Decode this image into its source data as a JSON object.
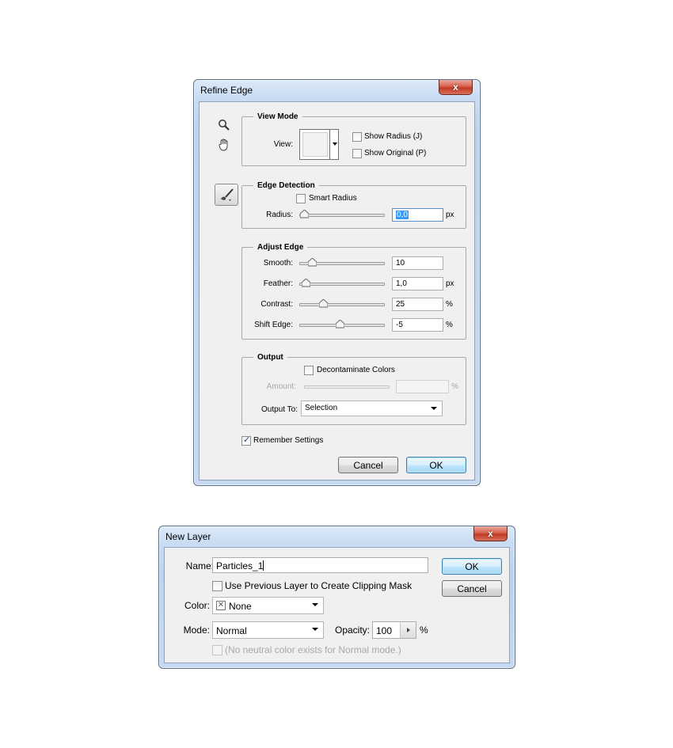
{
  "refine_edge": {
    "title": "Refine Edge",
    "close_label": "x",
    "view_mode": {
      "legend": "View Mode",
      "view_label": "View:",
      "show_radius": {
        "label": "Show Radius (J)",
        "checked": false
      },
      "show_original": {
        "label": "Show Original (P)",
        "checked": false
      }
    },
    "edge_detection": {
      "legend": "Edge Detection",
      "smart_radius": {
        "label": "Smart Radius",
        "checked": false
      },
      "radius_label": "Radius:",
      "radius_value": "0,0",
      "radius_unit": "px",
      "radius_slider_fraction": 0.0
    },
    "adjust_edge": {
      "legend": "Adjust Edge",
      "rows": [
        {
          "label": "Smooth:",
          "value": "10",
          "unit": "",
          "slider_fraction": 0.1
        },
        {
          "label": "Feather:",
          "value": "1,0",
          "unit": "px",
          "slider_fraction": 0.02
        },
        {
          "label": "Contrast:",
          "value": "25",
          "unit": "%",
          "slider_fraction": 0.25
        },
        {
          "label": "Shift Edge:",
          "value": "-5",
          "unit": "%",
          "slider_fraction": 0.475
        }
      ]
    },
    "output": {
      "legend": "Output",
      "decontaminate": {
        "label": "Decontaminate Colors",
        "checked": false
      },
      "amount_label": "Amount:",
      "amount_value": "",
      "amount_unit": "%",
      "output_to_label": "Output To:",
      "output_to_value": "Selection"
    },
    "remember": {
      "label": "Remember Settings",
      "checked": true
    },
    "cancel_label": "Cancel",
    "ok_label": "OK"
  },
  "new_layer": {
    "title": "New Layer",
    "close_label": "x",
    "name_label": "Name:",
    "name_value": "Particles_1",
    "clip_mask": {
      "label": "Use Previous Layer to Create Clipping Mask",
      "checked": false
    },
    "color_label": "Color:",
    "color_value": "None",
    "mode_label": "Mode:",
    "mode_value": "Normal",
    "opacity_label": "Opacity:",
    "opacity_value": "100",
    "opacity_unit": "%",
    "neutral_note": "(No neutral color exists for Normal mode.)",
    "ok_label": "OK",
    "cancel_label": "Cancel"
  }
}
